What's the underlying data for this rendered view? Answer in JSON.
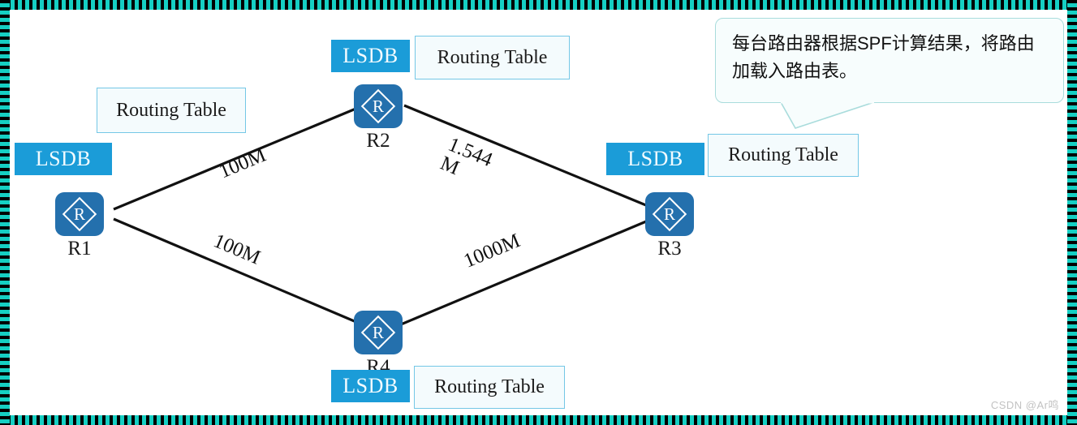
{
  "frame": {
    "stripe_color": "#15cfc3",
    "stripe_alt_color": "#000000"
  },
  "theme": {
    "router_fill": "#2470ad",
    "lsdb_fill": "#1b9cd8",
    "rtbox_border": "#74c7e6",
    "rtbox_fill": "#f4fbfd",
    "callout_border": "#a9dcdc",
    "link_color": "#111111"
  },
  "routers": [
    {
      "id": "r1",
      "label": "R1",
      "glyph": "R"
    },
    {
      "id": "r2",
      "label": "R2",
      "glyph": "R"
    },
    {
      "id": "r3",
      "label": "R3",
      "glyph": "R"
    },
    {
      "id": "r4",
      "label": "R4",
      "glyph": "R"
    }
  ],
  "lsdb_chips": [
    {
      "id": "r1",
      "label": "LSDB"
    },
    {
      "id": "r2",
      "label": "LSDB"
    },
    {
      "id": "r3",
      "label": "LSDB"
    },
    {
      "id": "r4",
      "label": "LSDB"
    }
  ],
  "routing_tables": [
    {
      "id": "r1",
      "label": "Routing Table"
    },
    {
      "id": "r2",
      "label": "Routing Table"
    },
    {
      "id": "r3",
      "label": "Routing Table"
    },
    {
      "id": "r4",
      "label": "Routing Table"
    }
  ],
  "links": [
    {
      "id": "r1-r2",
      "from": "R1",
      "to": "R2",
      "bandwidth": "100M"
    },
    {
      "id": "r2-r3",
      "from": "R2",
      "to": "R3",
      "bandwidth": "1.544\nM"
    },
    {
      "id": "r1-r4",
      "from": "R1",
      "to": "R4",
      "bandwidth": "100M"
    },
    {
      "id": "r4-r3",
      "from": "R4",
      "to": "R3",
      "bandwidth": "1000M"
    }
  ],
  "callout": {
    "text": "每台路由器根据SPF计算结果，将路由加载入路由表。"
  },
  "watermark": {
    "text": "CSDN @Ar鸣"
  }
}
